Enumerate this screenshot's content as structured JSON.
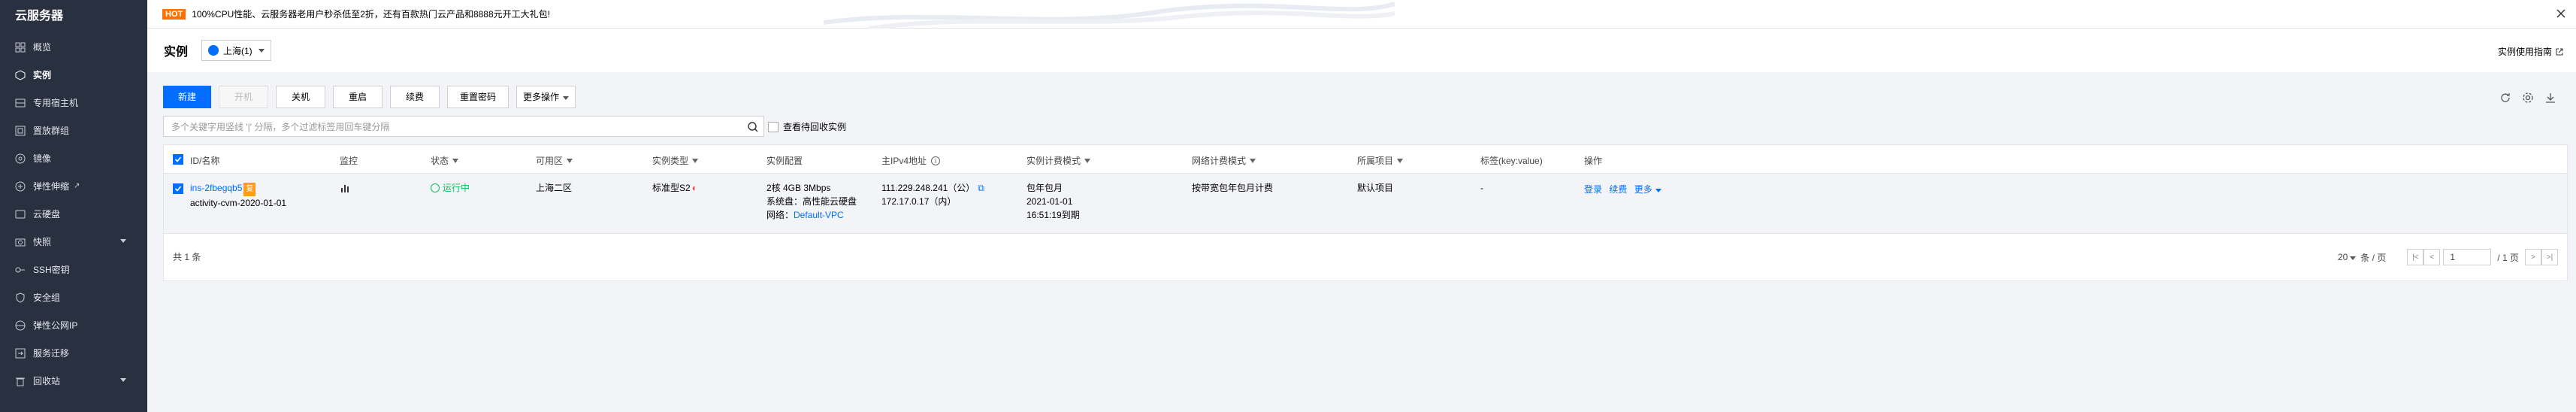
{
  "sidebar": {
    "title": "云服务器",
    "items": [
      {
        "label": "概览",
        "icon": "dashboard-icon"
      },
      {
        "label": "实例",
        "icon": "instance-icon",
        "active": true
      },
      {
        "label": "专用宿主机",
        "icon": "host-icon"
      },
      {
        "label": "置放群组",
        "icon": "group-icon"
      },
      {
        "label": "镜像",
        "icon": "image-icon"
      },
      {
        "label": "弹性伸缩",
        "icon": "scaling-icon",
        "external": true
      },
      {
        "label": "云硬盘",
        "icon": "disk-icon"
      },
      {
        "label": "快照",
        "icon": "snapshot-icon",
        "expandable": true
      },
      {
        "label": "SSH密钥",
        "icon": "key-icon"
      },
      {
        "label": "安全组",
        "icon": "shield-icon"
      },
      {
        "label": "弹性公网IP",
        "icon": "eip-icon"
      },
      {
        "label": "服务迁移",
        "icon": "migrate-icon"
      },
      {
        "label": "回收站",
        "icon": "recycle-icon",
        "expandable": true
      }
    ]
  },
  "notice": {
    "badge": "HOT",
    "text": "100%CPU性能、云服务器老用户秒杀低至2折，还有百款热门云产品和8888元开工大礼包!"
  },
  "header": {
    "title": "实例",
    "region": "上海(1)",
    "guide": "实例使用指南"
  },
  "toolbar": {
    "new": "新建",
    "start": "开机",
    "shutdown": "关机",
    "restart": "重启",
    "renew": "续费",
    "reset_password": "重置密码",
    "more": "更多操作"
  },
  "search": {
    "placeholder": "多个关键字用竖线 '|' 分隔，多个过滤标签用回车键分隔"
  },
  "recycle_check": "查看待回收实例",
  "table": {
    "headers": {
      "id": "ID/名称",
      "monitor": "监控",
      "status": "状态",
      "zone": "可用区",
      "type": "实例类型",
      "config": "实例配置",
      "ip": "主IPv4地址",
      "billing": "实例计费模式",
      "network_billing": "网络计费模式",
      "project": "所属项目",
      "tag": "标签(key:value)",
      "ops": "操作"
    },
    "row": {
      "id": "ins-2fbegqb5",
      "id_badge": "复",
      "name": "activity-cvm-2020-01-01",
      "status": "运行中",
      "zone": "上海二区",
      "type": "标准型S2",
      "config_line1": "2核 4GB 3Mbps",
      "config_line2": "系统盘：高性能云硬盘",
      "config_line3_label": "网络：",
      "config_line3_link": "Default-VPC",
      "ip_public": "111.229.248.241（公）",
      "ip_private": "172.17.0.17（内）",
      "billing_line1": "包年包月",
      "billing_line2": "2021-01-01",
      "billing_line3": "16:51:19到期",
      "network_billing": "按带宽包年包月计费",
      "project": "默认项目",
      "tag": "-",
      "op_login": "登录",
      "op_renew": "续费",
      "op_more": "更多"
    },
    "footer": {
      "total": "共 1 条",
      "page_size": "20",
      "per_page": "条 / 页",
      "page": "1",
      "page_total": "/ 1 页"
    }
  },
  "colors": {
    "sidebar_bg": "#293040",
    "primary": "#006eff",
    "hot": "#ff7200",
    "running": "#0abf5b"
  }
}
